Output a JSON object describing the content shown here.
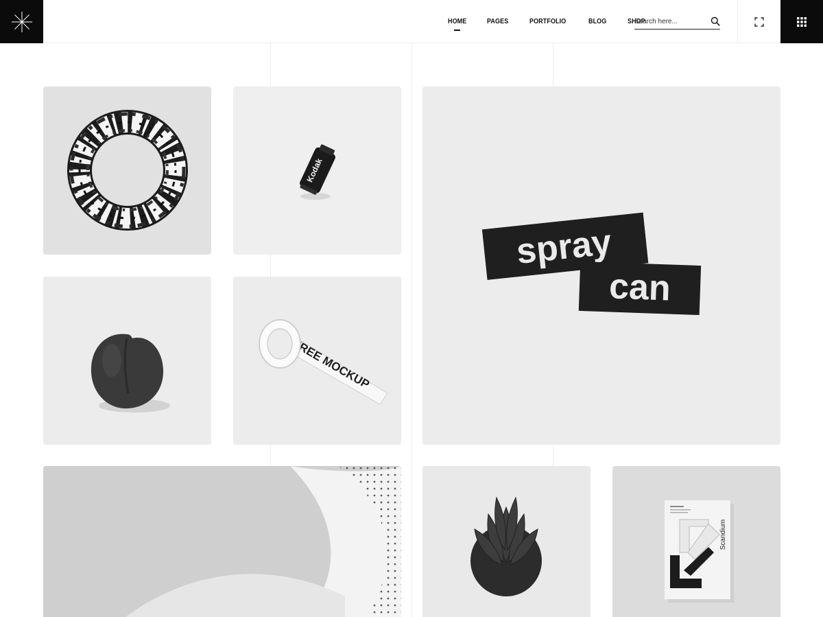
{
  "header": {
    "nav": [
      {
        "label": "HOME",
        "active": true
      },
      {
        "label": "PAGES",
        "active": false
      },
      {
        "label": "PORTFOLIO",
        "active": false
      },
      {
        "label": "BLOG",
        "active": false
      },
      {
        "label": "SHOP",
        "active": false
      }
    ],
    "search_placeholder": "Search here...",
    "logo_icon": "asterisk-logo-icon",
    "fullscreen_icon": "fullscreen-icon",
    "menu_icon": "grid-menu-icon"
  },
  "gallery": {
    "spray_can": {
      "line1": "spray",
      "line2": "can"
    },
    "kodak": {
      "brand": "Kodak"
    },
    "tape": {
      "text": "FREE MOCKUP"
    },
    "poster": {
      "title": "Scandium"
    }
  },
  "colors": {
    "dark": "#0b0b0b",
    "tile_bg": "#ececec",
    "guide": "#ececec"
  }
}
